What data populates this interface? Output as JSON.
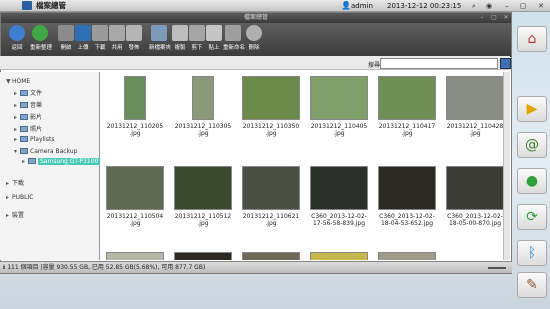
{
  "app": {
    "title": "檔案總管",
    "window_title": "檔案總管"
  },
  "topbar": {
    "user": "admin",
    "datetime": "2013-12-12 00:23:15"
  },
  "toolbar": {
    "buttons": [
      {
        "label": "返回",
        "icon": "back-icon"
      },
      {
        "label": "重新整理",
        "icon": "refresh-icon"
      },
      {
        "label": "開啟",
        "icon": "open-icon"
      },
      {
        "label": "上傳",
        "icon": "upload-icon"
      },
      {
        "label": "下載",
        "icon": "download-icon"
      },
      {
        "label": "共用",
        "icon": "share-icon"
      },
      {
        "label": "發佈",
        "icon": "publish-icon"
      },
      {
        "label": "新檔案夾",
        "icon": "new-folder-icon"
      },
      {
        "label": "複製",
        "icon": "copy-icon"
      },
      {
        "label": "剪下",
        "icon": "cut-icon"
      },
      {
        "label": "貼上",
        "icon": "paste-icon"
      },
      {
        "label": "重新命名",
        "icon": "rename-icon"
      },
      {
        "label": "刪除",
        "icon": "delete-icon"
      }
    ],
    "search_label": "搜尋"
  },
  "tree": {
    "home": "HOME",
    "items": [
      "文件",
      "音樂",
      "影片",
      "照片",
      "Playlists",
      "Camera Backup",
      "Samsung GT-P3100"
    ],
    "downloads": "下載",
    "public": "PUBLIC",
    "devices": "裝置"
  },
  "files": [
    {
      "name": "20131212_110205 .jpg",
      "color": "#6b8f5c"
    },
    {
      "name": "20131212_110305 .jpg",
      "color": "#8a9a78"
    },
    {
      "name": "20131212_110350 .jpg",
      "color": "#6c8b4a"
    },
    {
      "name": "20131212_110405 .jpg",
      "color": "#7fa06a"
    },
    {
      "name": "20131212_110417 .jpg",
      "color": "#6e8f58"
    },
    {
      "name": "20131212_110428 .jpg",
      "color": "#8a8d86"
    },
    {
      "name": "20131212_110504 .jpg",
      "color": "#5f6a55"
    },
    {
      "name": "20131212_110512 .jpg",
      "color": "#3c4a2e"
    },
    {
      "name": "20131212_110621 .jpg",
      "color": "#4a4f44"
    },
    {
      "name": "C360_2013-12-02- 17-56-58-839.jpg",
      "color": "#2b2f2a"
    },
    {
      "name": "C360_2013-12-02- 18-04-53-652.jpg",
      "color": "#2a2a22"
    },
    {
      "name": "C360_2013-12-02- 18-05-00-870.jpg",
      "color": "#3a3c35"
    }
  ],
  "status": {
    "text": "111 個項目 |容量 930.55 GB, 已用 52.85 GB(5.68%), 可用 877.7 GB)"
  }
}
